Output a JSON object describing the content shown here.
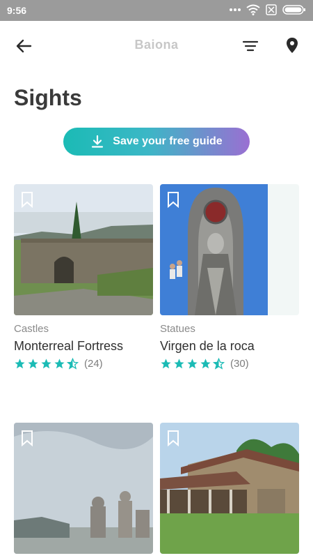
{
  "status_bar": {
    "time": "9:56",
    "icons": [
      "dots-icon",
      "wifi-icon",
      "no-sim-icon",
      "battery-icon"
    ]
  },
  "header": {
    "title": "Baiona",
    "back_icon": "arrow-left-icon",
    "filter_icon": "filter-icon",
    "map_icon": "map-pin-icon"
  },
  "page": {
    "title": "Sights"
  },
  "cta": {
    "label": "Save your free guide",
    "icon": "download-icon"
  },
  "colors": {
    "accent": "#1bbbb5",
    "gradient_end": "#9a6fd2",
    "star": "#1bbbb5"
  },
  "cards": [
    {
      "category": "Castles",
      "name": "Monterreal Fortress",
      "rating": 4.5,
      "count": "(24)"
    },
    {
      "category": "Statues",
      "name": "Virgen de la roca",
      "rating": 4.5,
      "count": "(30)"
    },
    {
      "category": "",
      "name": "",
      "rating": null,
      "count": ""
    },
    {
      "category": "",
      "name": "",
      "rating": null,
      "count": ""
    }
  ]
}
